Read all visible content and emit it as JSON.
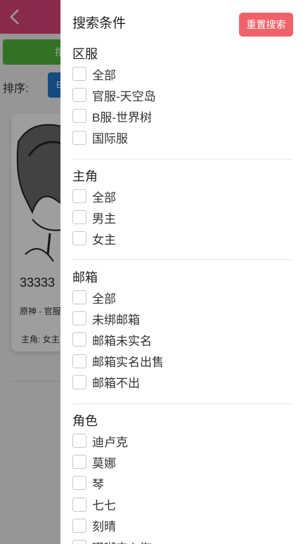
{
  "background": {
    "sort_label": "排序:",
    "card": {
      "title": "33333",
      "subtitle": "原神 - 官服",
      "role": "主角: 女主"
    }
  },
  "drawer": {
    "title": "搜索条件",
    "reset_label": "重置搜索",
    "sections": [
      {
        "title": "区服",
        "options": [
          "全部",
          "官服-天空岛",
          "B服-世界树",
          "国际服"
        ]
      },
      {
        "title": "主角",
        "options": [
          "全部",
          "男主",
          "女主"
        ]
      },
      {
        "title": "邮箱",
        "options": [
          "全部",
          "未绑邮箱",
          "邮箱未实名",
          "邮箱实名出售",
          "邮箱不出"
        ]
      },
      {
        "title": "角色",
        "options": [
          "迪卢克",
          "莫娜",
          "琴",
          "七七",
          "刻晴",
          "珊瑚宫心海"
        ]
      }
    ]
  }
}
